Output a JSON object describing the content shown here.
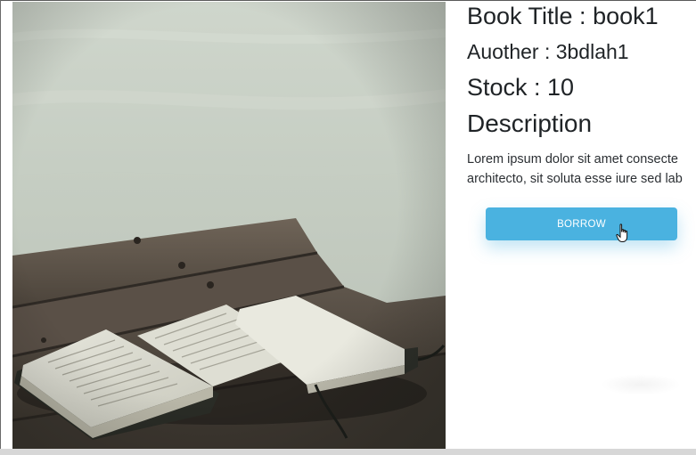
{
  "book": {
    "title_line": "Book Title : book1",
    "author_line": "Auother : 3bdlah1",
    "stock_line": "Stock : 10",
    "description_heading": "Description",
    "description_line_1": "Lorem ipsum dolor sit amet consecte",
    "description_line_2": "architecto, sit soluta esse iure sed lab"
  },
  "actions": {
    "borrow_label": "BORROW"
  },
  "image": {
    "subject": "open book on wooden bench",
    "icon": "book-photo"
  },
  "colors": {
    "accent": "#4ab2e0",
    "text": "#1f2326",
    "background": "#ffffff"
  }
}
